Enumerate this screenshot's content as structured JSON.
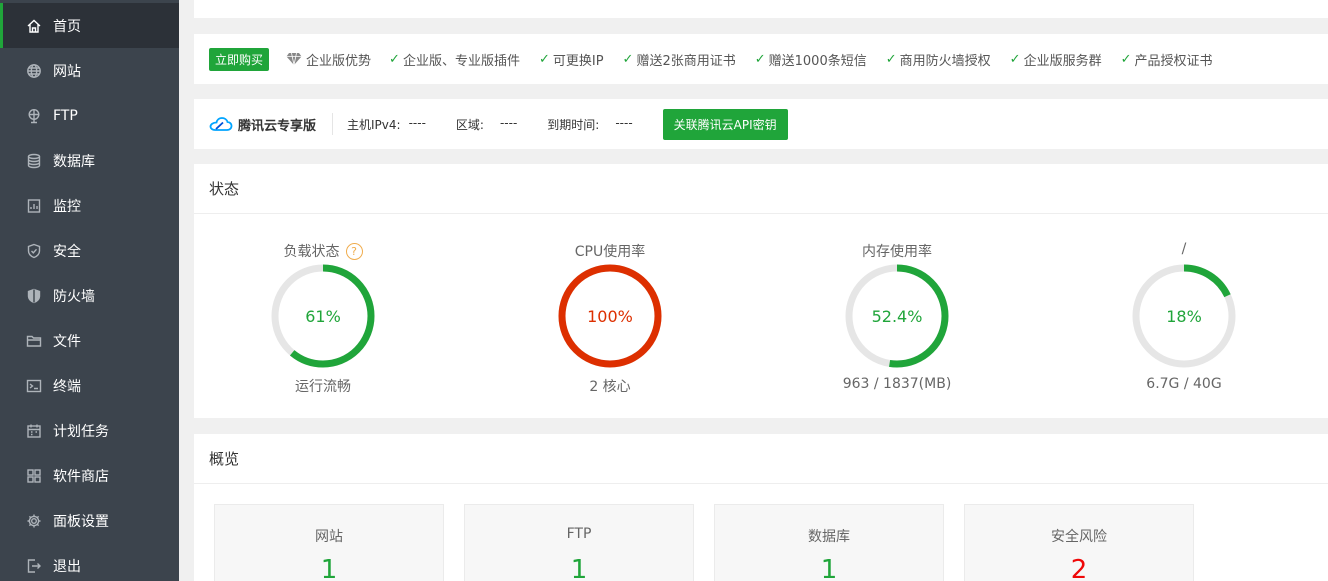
{
  "sidebar": {
    "items": [
      {
        "label": "首页",
        "icon": "home-icon",
        "active": true
      },
      {
        "label": "网站",
        "icon": "globe-icon"
      },
      {
        "label": "FTP",
        "icon": "ftp-icon"
      },
      {
        "label": "数据库",
        "icon": "database-icon"
      },
      {
        "label": "监控",
        "icon": "monitor-icon"
      },
      {
        "label": "安全",
        "icon": "shield-check-icon"
      },
      {
        "label": "防火墙",
        "icon": "firewall-shield-icon"
      },
      {
        "label": "文件",
        "icon": "folder-icon"
      },
      {
        "label": "终端",
        "icon": "terminal-icon"
      },
      {
        "label": "计划任务",
        "icon": "calendar-icon"
      },
      {
        "label": "软件商店",
        "icon": "grid-apps-icon"
      },
      {
        "label": "面板设置",
        "icon": "gear-icon"
      },
      {
        "label": "退出",
        "icon": "logout-icon"
      }
    ]
  },
  "enterprise_bar": {
    "buy_label": "立即购买",
    "advantage_label": "企业版优势",
    "features": [
      "企业版、专业版插件",
      "可更换IP",
      "赠送2张商用证书",
      "赠送1000条短信",
      "商用防火墙授权",
      "企业版服务群",
      "产品授权证书"
    ]
  },
  "tencent_bar": {
    "brand": "腾讯云专享版",
    "fields": [
      {
        "key": "主机IPv4:",
        "value": "----"
      },
      {
        "key": "区域:",
        "value": "----"
      },
      {
        "key": "到期时间:",
        "value": "----"
      }
    ],
    "api_button": "关联腾讯云API密钥"
  },
  "status": {
    "title": "状态",
    "gauges": [
      {
        "label": "负载状态",
        "value": "61%",
        "percent": 61,
        "sub": "运行流畅",
        "color": "#20a53a",
        "help": "?"
      },
      {
        "label": "CPU使用率",
        "value": "100%",
        "percent": 100,
        "sub": "2 核心",
        "color": "#dd2f00"
      },
      {
        "label": "内存使用率",
        "value": "52.4%",
        "percent": 52.4,
        "sub": "963 / 1837(MB)",
        "color": "#20a53a"
      },
      {
        "label": "/",
        "value": "18%",
        "percent": 18,
        "sub": "6.7G / 40G",
        "color": "#20a53a"
      }
    ]
  },
  "overview": {
    "title": "概览",
    "cards": [
      {
        "label": "网站",
        "value": "1"
      },
      {
        "label": "FTP",
        "value": "1"
      },
      {
        "label": "数据库",
        "value": "1"
      },
      {
        "label": "安全风险",
        "value": "2",
        "alert": true
      }
    ]
  },
  "colors": {
    "accent": "#20a53a",
    "danger": "#dd2f00",
    "sidebar_bg": "#3c444d",
    "alert": "#ef0808"
  }
}
